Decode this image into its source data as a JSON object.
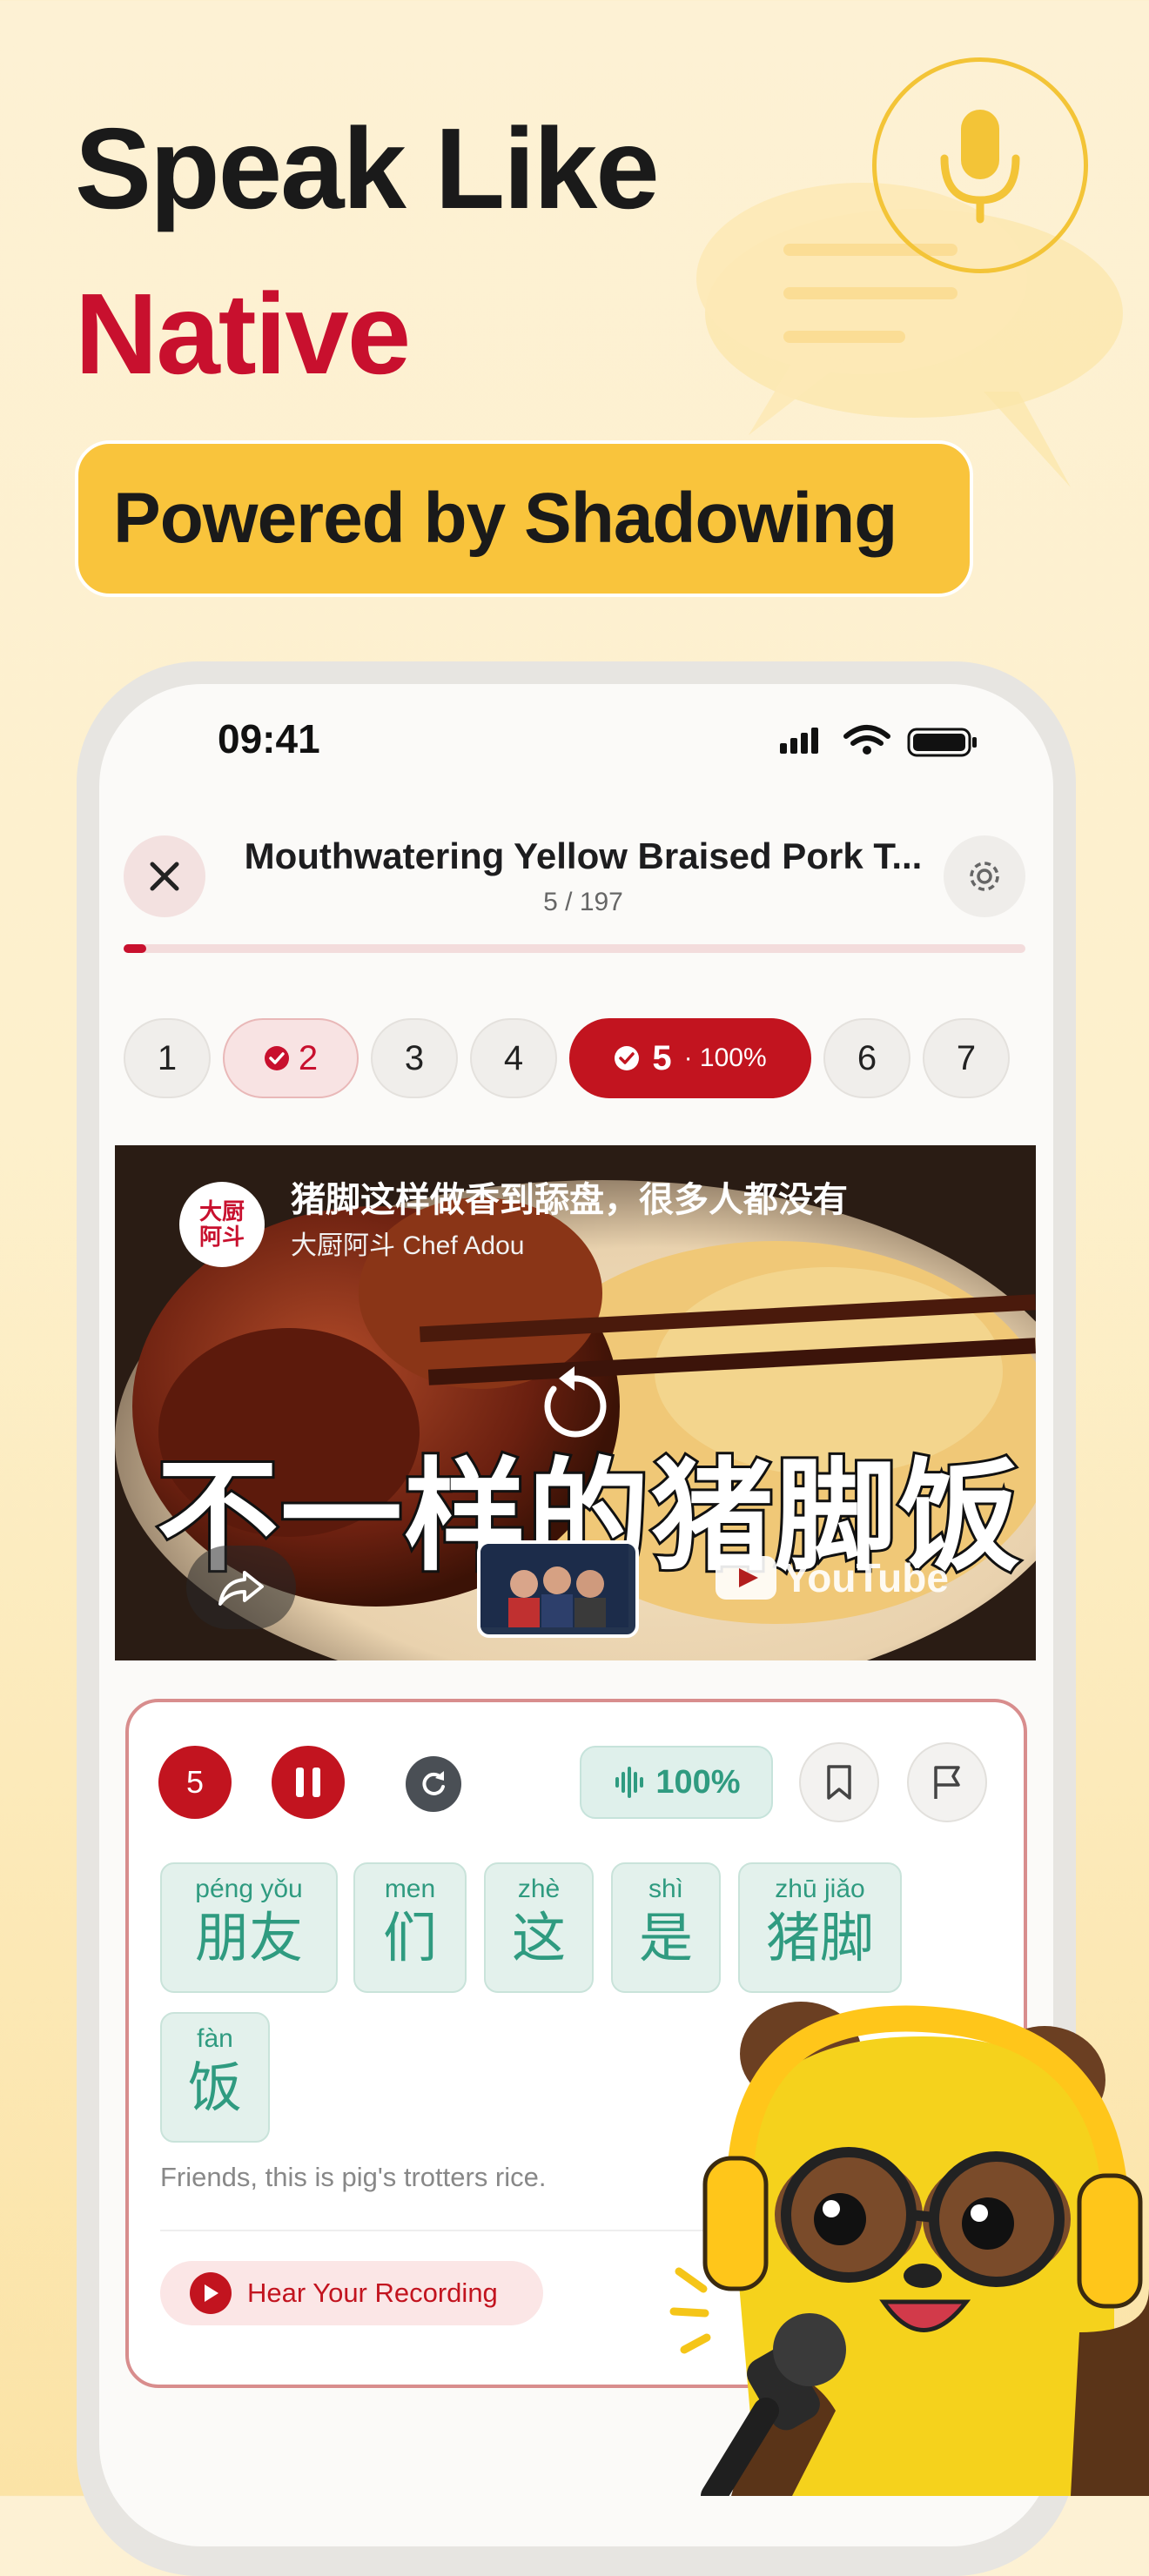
{
  "headline": {
    "line1": "Speak Like",
    "line2": "Native",
    "tagline": "Powered by Shadowing"
  },
  "status_bar": {
    "time": "09:41"
  },
  "header": {
    "title": "Mouthwatering Yellow Braised Pork T...",
    "count": "5 / 197"
  },
  "progress": {
    "current": 5,
    "total": 197
  },
  "chips": [
    {
      "label": "1",
      "state": "default"
    },
    {
      "label": "2",
      "state": "done"
    },
    {
      "label": "3",
      "state": "default"
    },
    {
      "label": "4",
      "state": "default"
    },
    {
      "label": "5",
      "sub": "· 100%",
      "state": "active"
    },
    {
      "label": "6",
      "state": "default"
    },
    {
      "label": "7",
      "state": "default"
    }
  ],
  "video": {
    "channel_logo": "大厨\n阿斗",
    "title": "猪脚这样做香到舔盘，很多人都没有",
    "channel": "大厨阿斗 Chef Adou",
    "caption": "不一样的猪脚饭",
    "watermark": "YouTube"
  },
  "sentence": {
    "number": "5",
    "score": "100%",
    "words": [
      {
        "pinyin": "péng yǒu",
        "hanzi": "朋友"
      },
      {
        "pinyin": "men",
        "hanzi": "们"
      },
      {
        "pinyin": "zhè",
        "hanzi": "这"
      },
      {
        "pinyin": "shì",
        "hanzi": "是"
      },
      {
        "pinyin": "zhū jiǎo",
        "hanzi": "猪脚"
      },
      {
        "pinyin": "fàn",
        "hanzi": "饭"
      }
    ],
    "translation": "Friends, this is pig's trotters rice.",
    "hear_label": "Hear Your Recording"
  },
  "colors": {
    "accent": "#c8102e",
    "brand_yellow": "#f9c43c",
    "teal": "#2f9b80"
  }
}
